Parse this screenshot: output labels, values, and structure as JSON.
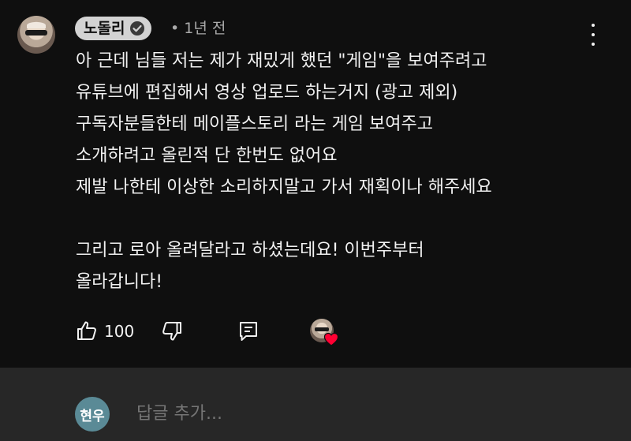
{
  "comment": {
    "author": "노돌리",
    "verified": true,
    "timestamp": "• 1년 전",
    "text": "아 근데 님들 저는 제가 재밌게 했던 \"게임\"을 보여주려고\n유튜브에 편집해서 영상 업로드 하는거지 (광고 제외)\n구독자분들한테 메이플스토리 라는 게임 보여주고\n소개하려고 올린적 단 한번도 없어요\n제발 나한테 이상한 소리하지말고 가서 재획이나 해주세요\n\n그리고 로아 올려달라고 하셨는데요! 이번주부터\n올라갑니다!",
    "like_count": "100",
    "creator_hearted": true
  },
  "icons": {
    "more": "more-vertical-icon",
    "like": "thumbs-up-icon",
    "dislike": "thumbs-down-icon",
    "reply": "reply-icon",
    "verified": "verified-check-icon",
    "heart": "heart-icon"
  },
  "colors": {
    "background": "#0f0f0f",
    "reply_bar": "#272727",
    "heart": "#ff0033",
    "reply_avatar": "#5a8a96"
  },
  "reply_box": {
    "avatar_text": "현우",
    "placeholder": "답글 추가..."
  }
}
